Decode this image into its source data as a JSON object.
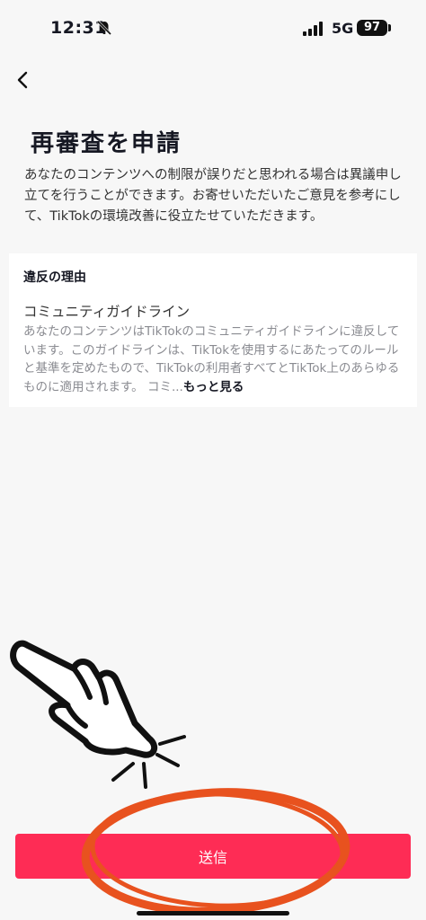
{
  "status_bar": {
    "time": "12:31",
    "network": "5G",
    "battery": "97",
    "icons": [
      "bell-slash-icon",
      "signal-bars-icon",
      "battery-icon"
    ]
  },
  "header": {
    "back_icon": "chevron-left-icon",
    "title": "再審査を申請"
  },
  "description": "あなたのコンテンツへの制限が誤りだと思われる場合は異議申し立てを行うことができます。お寄せいただいたご意見を参考にして、TikTokの環境改善に役立たせていただきます。",
  "violation": {
    "heading": "違反の理由",
    "guideline_title": "コミュニティガイドライン",
    "guideline_body": "あなたのコンテンツはTikTokのコミュニティガイドラインに違反しています。このガイドラインは、TikTokを使用するにあたってのルールと基準を定めたもので、TikTokの利用者すべてとTikTok上のあらゆるものに適用されます。 コミ...",
    "more_label": "もっと見る"
  },
  "submit_label": "送信",
  "colors": {
    "accent": "#fe2c55",
    "annotation": "#e8521f",
    "background": "#f7f7f7"
  }
}
